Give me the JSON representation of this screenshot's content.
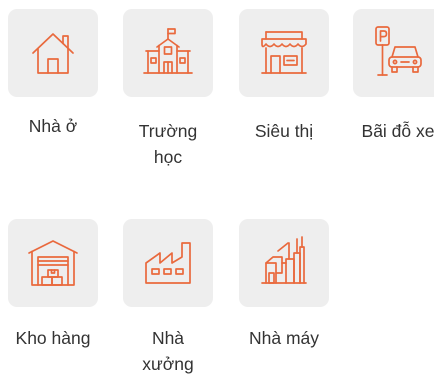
{
  "accent_color": "#e9693d",
  "tile_background": "#eeeeee",
  "items": [
    {
      "label": "Nhà ở",
      "icon": "house-icon"
    },
    {
      "label": "Trường học",
      "icon": "school-icon"
    },
    {
      "label": "Siêu thị",
      "icon": "supermarket-icon"
    },
    {
      "label": "Bãi đỗ xe",
      "icon": "parking-icon"
    },
    {
      "label": "Kho hàng",
      "icon": "warehouse-icon"
    },
    {
      "label": "Nhà xưởng",
      "icon": "workshop-icon"
    },
    {
      "label": "Nhà máy",
      "icon": "factory-icon"
    }
  ]
}
